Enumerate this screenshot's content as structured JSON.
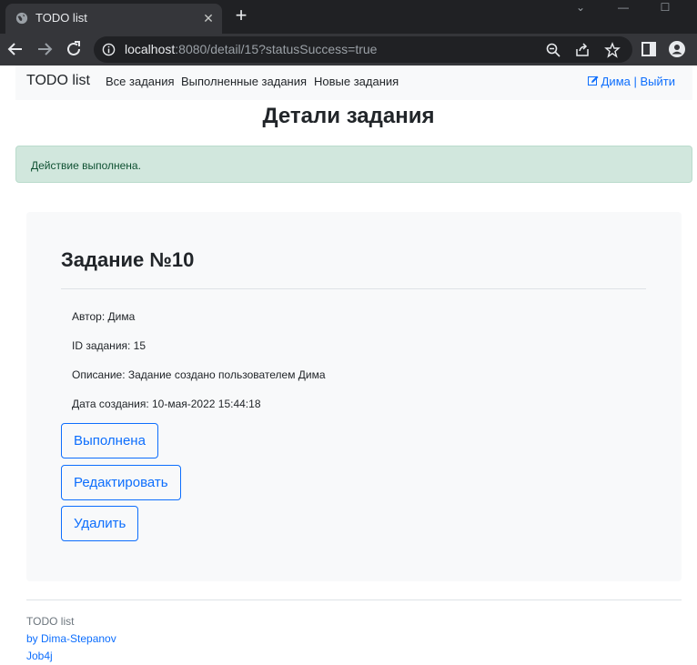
{
  "browser": {
    "tab_title": "TODO list",
    "url_host": "localhost",
    "url_rest": ":8080/detail/15?statusSuccess=true",
    "icons": [
      "globe-icon",
      "close-icon",
      "plus-icon",
      "back-icon",
      "forward-icon",
      "reload-icon",
      "info-icon",
      "zoom-icon",
      "share-icon",
      "star-icon",
      "side-panel-icon",
      "profile-icon"
    ]
  },
  "navbar": {
    "brand": "TODO list",
    "links": [
      "Все задания",
      "Выполненные задания",
      "Новые задания"
    ],
    "user_name": "Дима",
    "separator": "|",
    "logout": "Выйти"
  },
  "page": {
    "title": "Детали задания",
    "alert": "Действие выполнена."
  },
  "task": {
    "title": "Задание №10",
    "author": "Автор: Дима",
    "id": "ID задания: 15",
    "description": "Описание: Задание создано пользователем Дима",
    "created": "Дата создания: 10-мая-2022 15:44:18"
  },
  "actions": {
    "complete": "Выполнена",
    "edit": "Редактировать",
    "delete": "Удалить"
  },
  "footer": {
    "brand": "TODO list",
    "author_link": "by Dima-Stepanov",
    "school_link": "Job4j"
  },
  "colors": {
    "accent": "#0d6efd",
    "alert_bg": "#d1e7dd",
    "alert_text": "#0f5132",
    "card_bg": "#f8f9fa"
  }
}
